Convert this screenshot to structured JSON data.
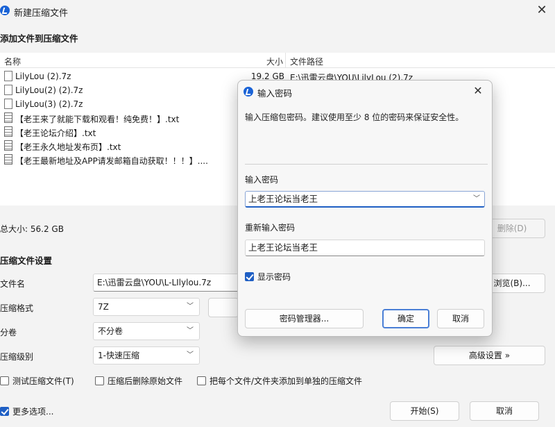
{
  "window": {
    "title": "新建压缩文件",
    "close_glyph": "✕"
  },
  "add_files": {
    "heading": "添加文件到压缩文件",
    "columns": {
      "name": "名称",
      "size": "大小",
      "path": "文件路径"
    },
    "files": [
      {
        "name": "LilyLou (2).7z",
        "size": "19.2 GB",
        "path": "E:\\迅雷云盘\\YOU\\LilyLou (2).7z",
        "icon": "archive-file-icon"
      },
      {
        "name": "LilyLou(2) (2).7z",
        "size": "",
        "path": "",
        "icon": "archive-file-icon"
      },
      {
        "name": "LilyLou(3) (2).7z",
        "size": "",
        "path": "",
        "icon": "archive-file-icon"
      },
      {
        "name": "【老王来了就能下载和观看！纯免费！】.txt",
        "size": "",
        "path": "",
        "icon": "text-file-icon"
      },
      {
        "name": "【老王论坛介绍】.txt",
        "size": "",
        "path": "",
        "icon": "text-file-icon"
      },
      {
        "name": "【老王永久地址发布页】.txt",
        "size": "",
        "path": "",
        "icon": "text-file-icon"
      },
      {
        "name": "【老王最新地址及APP请发邮箱自动获取！！！】....",
        "size": "",
        "path": "",
        "icon": "text-file-icon"
      }
    ],
    "total_size": "总大小: 56.2 GB",
    "delete_button": "删除(D)"
  },
  "settings": {
    "heading": "压缩文件设置",
    "filename_label": "文件名",
    "filename_value": "E:\\迅雷云盘\\YOU\\L-LIlylou.7z",
    "browse_button": "浏览(B)...",
    "format_label": "压缩格式",
    "format_value": "7Z",
    "volume_label": "分卷",
    "volume_value": "不分卷",
    "level_label": "压缩级别",
    "level_value": "1-快速压缩",
    "advanced_button": "高级设置 »",
    "test_checkbox": "测试压缩文件(T)",
    "delete_source_checkbox": "压缩后删除原始文件",
    "separate_checkbox": "把每个文件/文件夹添加到单独的压缩文件",
    "more_options_checkbox": "更多选项...",
    "start_button": "开始(S)",
    "cancel_button": "取消"
  },
  "password_dialog": {
    "title": "输入密码",
    "close_glyph": "✕",
    "description": "输入压缩包密码。建议使用至少 8 位的密码来保证安全性。",
    "password_label": "输入密码",
    "password_value": "上老王论坛当老王",
    "confirm_label": "重新输入密码",
    "confirm_value": "上老王论坛当老王",
    "show_password": "显示密码",
    "manager_button": "密码管理器...",
    "ok_button": "确定",
    "cancel_button": "取消"
  }
}
